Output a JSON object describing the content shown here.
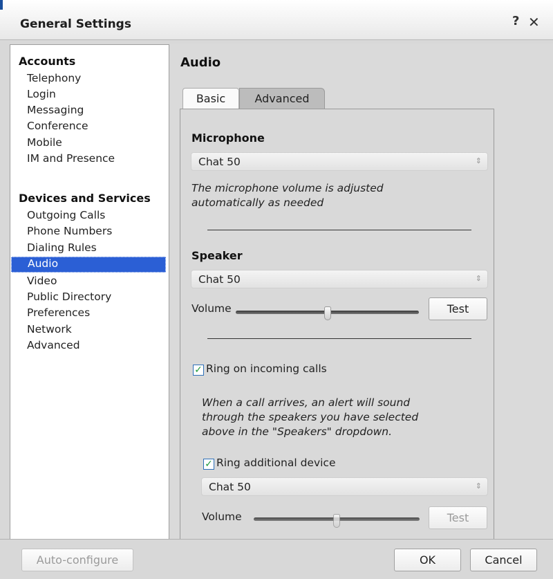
{
  "window": {
    "title": "General Settings",
    "help_icon": "?",
    "close_icon": "✕"
  },
  "sidebar": {
    "groups": [
      {
        "label": "Accounts"
      },
      {
        "label": "Devices and Services"
      }
    ],
    "accounts_items": [
      "Telephony",
      "Login",
      "Messaging",
      "Conference",
      "Mobile",
      "IM and Presence"
    ],
    "devices_items": [
      "Outgoing Calls",
      "Phone Numbers",
      "Dialing Rules",
      "Audio",
      "Video",
      "Public Directory",
      "Preferences",
      "Network",
      "Advanced"
    ],
    "selected": "Audio"
  },
  "main": {
    "title": "Audio",
    "tabs": [
      {
        "label": "Basic"
      },
      {
        "label": "Advanced"
      }
    ],
    "active_tab": "Advanced",
    "microphone": {
      "heading": "Microphone",
      "device": "Chat 50",
      "note_line1": "The microphone volume is adjusted",
      "note_line2": "automatically as needed"
    },
    "speaker": {
      "heading": "Speaker",
      "device": "Chat 50",
      "volume_label": "Volume",
      "volume_level": 0.5,
      "test_label": "Test"
    },
    "ring": {
      "checkbox_label": "Ring on incoming calls",
      "checked": true,
      "note_line1": "When a call arrives, an alert will sound",
      "note_line2": "through the speakers you have selected",
      "note_line3": "above in the \"Speakers\" dropdown.",
      "additional_label": "Ring additional device",
      "additional_checked": true,
      "additional_device": "Chat 50",
      "volume_label": "Volume",
      "volume_level": 0.5,
      "test_label": "Test"
    }
  },
  "footer": {
    "auto_configure_label": "Auto-configure",
    "ok_label": "OK",
    "cancel_label": "Cancel"
  },
  "icons": {
    "select_arrows": "⇕",
    "check_mark": "✓"
  },
  "colors": {
    "selection": "#2b5fd5",
    "check": "#1f9a3a"
  }
}
